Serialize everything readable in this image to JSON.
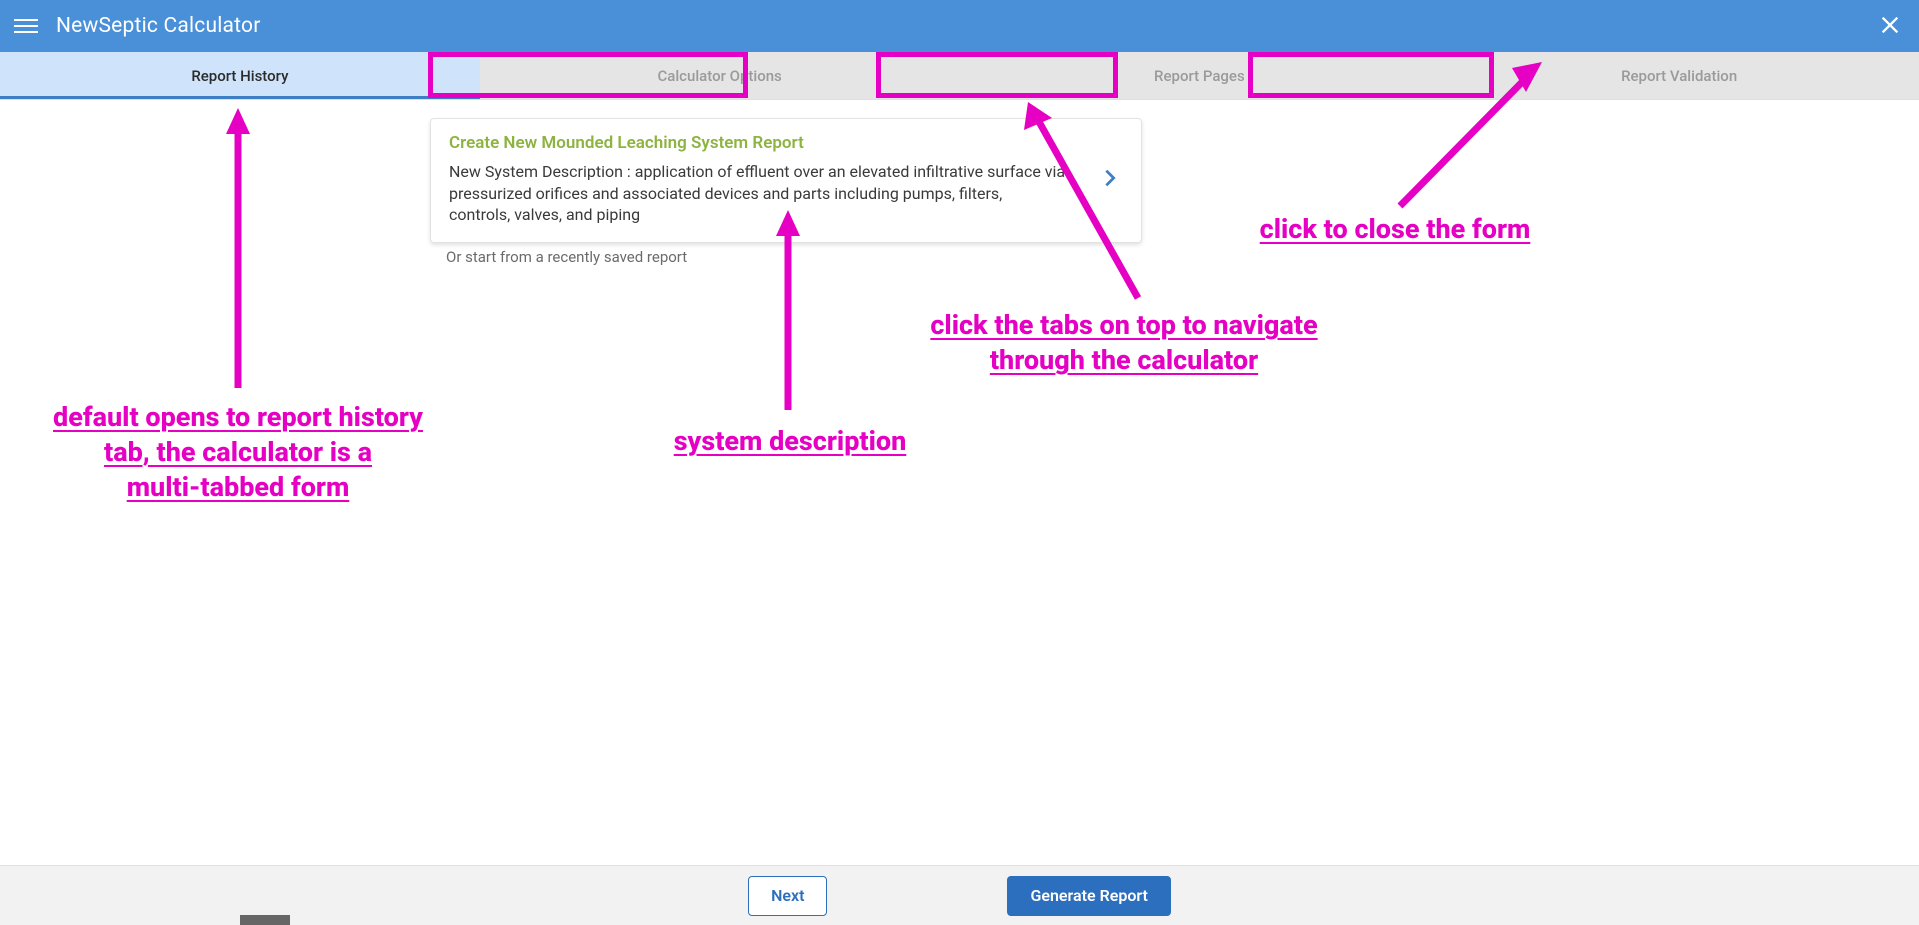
{
  "colors": {
    "primary": "#4a90d9",
    "accent_green": "#8db340",
    "magenta": "#e500c3",
    "button_blue": "#2c6fbe"
  },
  "app": {
    "title": "NewSeptic Calculator"
  },
  "tabs": [
    {
      "id": "history",
      "label": "Report History",
      "active": true
    },
    {
      "id": "options",
      "label": "Calculator Options",
      "active": false
    },
    {
      "id": "pages",
      "label": "Report Pages",
      "active": false
    },
    {
      "id": "validation",
      "label": "Report Validation",
      "active": false
    }
  ],
  "card": {
    "title": "Create New Mounded Leaching System Report",
    "body": "New System Description : application of effluent over an elevated infiltrative surface via pressurized orifices and associated devices and parts including pumps, filters, controls, valves, and piping"
  },
  "recentLabel": "Or start from a recently saved report",
  "footer": {
    "next": "Next",
    "generate": "Generate Report"
  },
  "annotations": {
    "left": "default opens to report history\ntab, the calculator is a\nmulti-tabbed form",
    "center": "system description",
    "tabs": "click the tabs on top to navigate\nthrough the calculator",
    "close": "click to close the form"
  }
}
